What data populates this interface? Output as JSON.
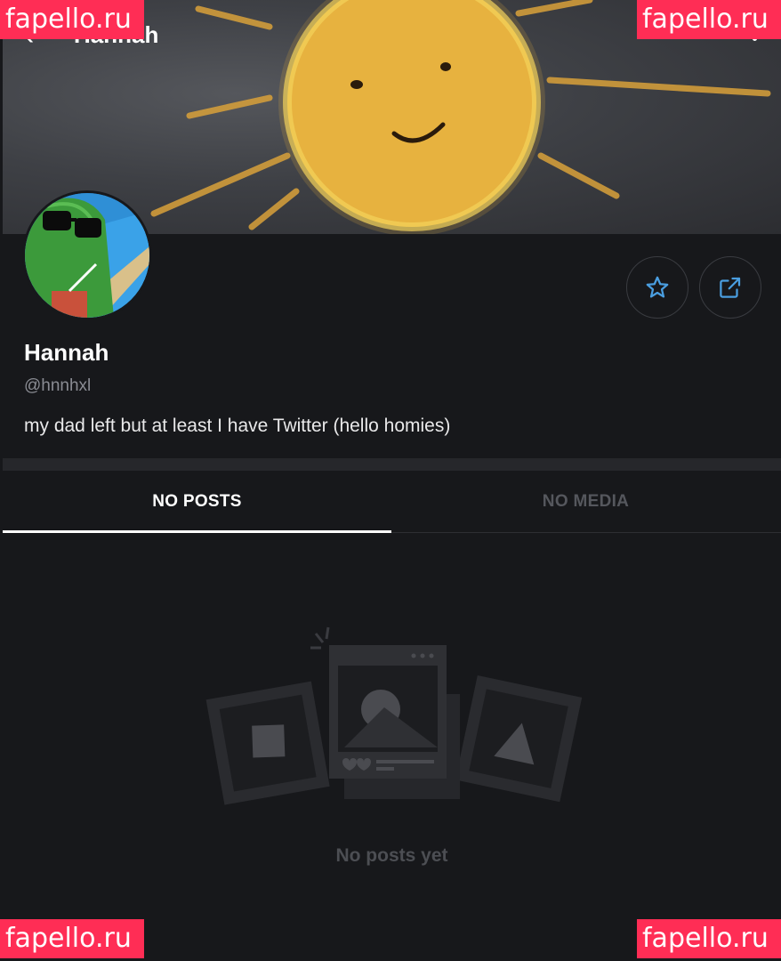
{
  "header": {
    "title": "Hannah",
    "back_icon": "chevron-left-icon",
    "more_icon": "more-vertical-icon"
  },
  "profile": {
    "name": "Hannah",
    "handle": "@hnnhxl",
    "bio": "my dad left but at least I have Twitter (hello homies)"
  },
  "actions": {
    "favorite_icon": "star-icon",
    "share_icon": "share-icon"
  },
  "tabs": [
    {
      "label": "NO POSTS",
      "active": true
    },
    {
      "label": "NO MEDIA",
      "active": false
    }
  ],
  "empty_state": {
    "message": "No posts yet",
    "icon": "empty-posts-illustration"
  },
  "watermarks": [
    "fapello.ru",
    "fapello.ru",
    "fapello.ru",
    "fapello.ru"
  ],
  "colors": {
    "background": "#17181b",
    "accent": "#4a9ee0",
    "watermark": "#ff2d55"
  }
}
